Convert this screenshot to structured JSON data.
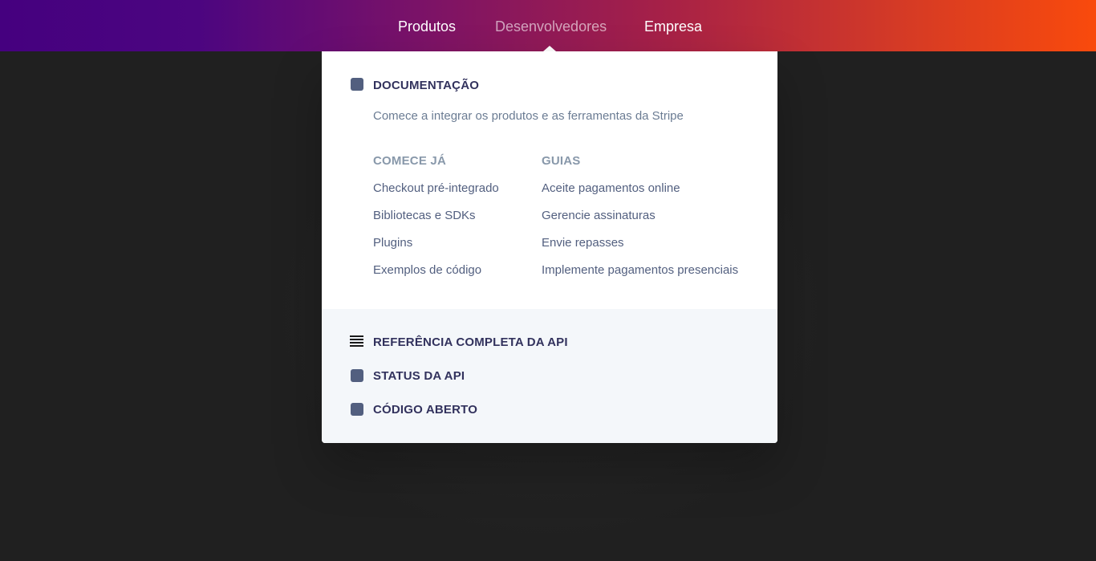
{
  "nav": {
    "items": [
      {
        "label": "Produtos"
      },
      {
        "label": "Desenvolvedores"
      },
      {
        "label": "Empresa"
      }
    ]
  },
  "dropdown": {
    "documentation": {
      "title": "DOCUMENTAÇÃO",
      "subtitle": "Comece a integrar os produtos e as ferramentas da Stripe",
      "icon": "docs-icon"
    },
    "columns": [
      {
        "title": "COMECE JÁ",
        "links": [
          "Checkout pré-integrado",
          "Bibliotecas e SDKs",
          "Plugins",
          "Exemplos de código"
        ]
      },
      {
        "title": "GUIAS",
        "links": [
          "Aceite pagamentos online",
          "Gerencie assinaturas",
          "Envie repasses",
          "Implemente pagamentos presenciais"
        ]
      }
    ],
    "footer_links": [
      {
        "label": "REFERÊNCIA COMPLETA DA API",
        "icon": "menu-list-icon"
      },
      {
        "label": "STATUS DA API",
        "icon": "status-icon"
      },
      {
        "label": "CÓDIGO ABERTO",
        "icon": "open-source-icon"
      }
    ]
  },
  "colors": {
    "gradient_start": "#45007f",
    "gradient_end": "#f94a0c",
    "background": "#202020",
    "heading": "#32325d",
    "link": "#525f7f",
    "muted": "#8898aa",
    "footer_bg": "#f4f7fa"
  }
}
